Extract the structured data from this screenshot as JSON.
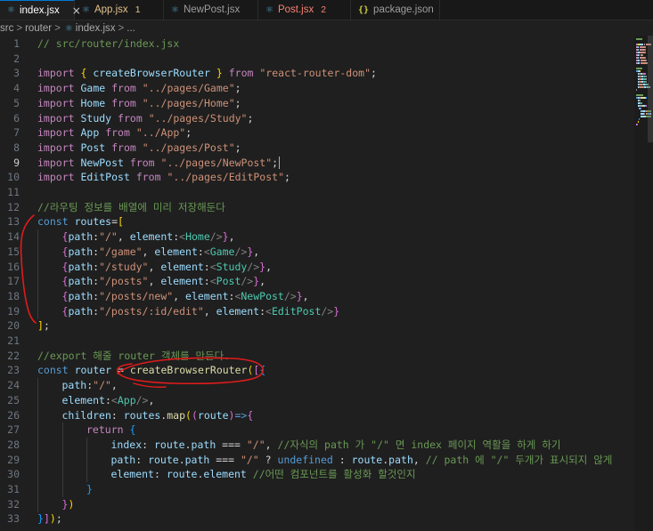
{
  "tabs": [
    {
      "label": "index.jsx",
      "icon": "react-icon",
      "active": true,
      "close": "×"
    },
    {
      "label": "App.jsx",
      "icon": "react-icon",
      "count": "1",
      "state": "modified"
    },
    {
      "label": "NewPost.jsx",
      "icon": "react-icon"
    },
    {
      "label": "Post.jsx",
      "icon": "react-icon",
      "count": "2",
      "state": "error"
    },
    {
      "label": "package.json",
      "icon": "json-icon",
      "icon_glyph": "{}"
    }
  ],
  "breadcrumb": [
    "src",
    "router",
    "index.jsx",
    "..."
  ],
  "breadcrumb_sep": ">",
  "current_line": 9,
  "lines": [
    {
      "n": "1",
      "indent": 0,
      "tokens": [
        {
          "c": "c",
          "t": "// src/router/index.jsx"
        }
      ]
    },
    {
      "n": "2",
      "indent": 0,
      "tokens": []
    },
    {
      "n": "3",
      "indent": 0,
      "tokens": [
        {
          "c": "kc",
          "t": "import"
        },
        {
          "c": "p",
          "t": " "
        },
        {
          "c": "b1",
          "t": "{"
        },
        {
          "c": "p",
          "t": " "
        },
        {
          "c": "v",
          "t": "createBrowserRouter"
        },
        {
          "c": "p",
          "t": " "
        },
        {
          "c": "b1",
          "t": "}"
        },
        {
          "c": "p",
          "t": " "
        },
        {
          "c": "kc",
          "t": "from"
        },
        {
          "c": "p",
          "t": " "
        },
        {
          "c": "s",
          "t": "\"react-router-dom\""
        },
        {
          "c": "p",
          "t": ";"
        }
      ]
    },
    {
      "n": "4",
      "indent": 0,
      "tokens": [
        {
          "c": "kc",
          "t": "import"
        },
        {
          "c": "p",
          "t": " "
        },
        {
          "c": "v",
          "t": "Game"
        },
        {
          "c": "p",
          "t": " "
        },
        {
          "c": "kc",
          "t": "from"
        },
        {
          "c": "p",
          "t": " "
        },
        {
          "c": "s",
          "t": "\"../pages/Game\""
        },
        {
          "c": "p",
          "t": ";"
        }
      ]
    },
    {
      "n": "5",
      "indent": 0,
      "tokens": [
        {
          "c": "kc",
          "t": "import"
        },
        {
          "c": "p",
          "t": " "
        },
        {
          "c": "v",
          "t": "Home"
        },
        {
          "c": "p",
          "t": " "
        },
        {
          "c": "kc",
          "t": "from"
        },
        {
          "c": "p",
          "t": " "
        },
        {
          "c": "s",
          "t": "\"../pages/Home\""
        },
        {
          "c": "p",
          "t": ";"
        }
      ]
    },
    {
      "n": "6",
      "indent": 0,
      "tokens": [
        {
          "c": "kc",
          "t": "import"
        },
        {
          "c": "p",
          "t": " "
        },
        {
          "c": "v",
          "t": "Study"
        },
        {
          "c": "p",
          "t": " "
        },
        {
          "c": "kc",
          "t": "from"
        },
        {
          "c": "p",
          "t": " "
        },
        {
          "c": "s",
          "t": "\"../pages/Study\""
        },
        {
          "c": "p",
          "t": ";"
        }
      ]
    },
    {
      "n": "7",
      "indent": 0,
      "tokens": [
        {
          "c": "kc",
          "t": "import"
        },
        {
          "c": "p",
          "t": " "
        },
        {
          "c": "v",
          "t": "App"
        },
        {
          "c": "p",
          "t": " "
        },
        {
          "c": "kc",
          "t": "from"
        },
        {
          "c": "p",
          "t": " "
        },
        {
          "c": "s",
          "t": "\"../App\""
        },
        {
          "c": "p",
          "t": ";"
        }
      ]
    },
    {
      "n": "8",
      "indent": 0,
      "tokens": [
        {
          "c": "kc",
          "t": "import"
        },
        {
          "c": "p",
          "t": " "
        },
        {
          "c": "v",
          "t": "Post"
        },
        {
          "c": "p",
          "t": " "
        },
        {
          "c": "kc",
          "t": "from"
        },
        {
          "c": "p",
          "t": " "
        },
        {
          "c": "s",
          "t": "\"../pages/Post\""
        },
        {
          "c": "p",
          "t": ";"
        }
      ]
    },
    {
      "n": "9",
      "indent": 0,
      "tokens": [
        {
          "c": "kc",
          "t": "import"
        },
        {
          "c": "p",
          "t": " "
        },
        {
          "c": "v",
          "t": "NewPost"
        },
        {
          "c": "p",
          "t": " "
        },
        {
          "c": "kc",
          "t": "from"
        },
        {
          "c": "p",
          "t": " "
        },
        {
          "c": "s",
          "t": "\"../pages/NewPost\""
        },
        {
          "c": "p",
          "t": ";"
        }
      ]
    },
    {
      "n": "10",
      "indent": 0,
      "tokens": [
        {
          "c": "kc",
          "t": "import"
        },
        {
          "c": "p",
          "t": " "
        },
        {
          "c": "v",
          "t": "EditPost"
        },
        {
          "c": "p",
          "t": " "
        },
        {
          "c": "kc",
          "t": "from"
        },
        {
          "c": "p",
          "t": " "
        },
        {
          "c": "s",
          "t": "\"../pages/EditPost\""
        },
        {
          "c": "p",
          "t": ";"
        }
      ]
    },
    {
      "n": "11",
      "indent": 0,
      "tokens": []
    },
    {
      "n": "12",
      "indent": 0,
      "tokens": [
        {
          "c": "c",
          "t": "//라우팅 정보를 배열에 미리 저장해둔다"
        }
      ]
    },
    {
      "n": "13",
      "indent": 0,
      "tokens": [
        {
          "c": "k",
          "t": "const"
        },
        {
          "c": "p",
          "t": " "
        },
        {
          "c": "v",
          "t": "routes"
        },
        {
          "c": "p",
          "t": "="
        },
        {
          "c": "b1",
          "t": "["
        }
      ]
    },
    {
      "n": "14",
      "indent": 1,
      "tokens": [
        {
          "c": "b2",
          "t": "{"
        },
        {
          "c": "v",
          "t": "path"
        },
        {
          "c": "p",
          "t": ":"
        },
        {
          "c": "s",
          "t": "\"/\""
        },
        {
          "c": "p",
          "t": ", "
        },
        {
          "c": "v",
          "t": "element"
        },
        {
          "c": "p",
          "t": ":"
        },
        {
          "c": "g",
          "t": "<"
        },
        {
          "c": "t",
          "t": "Home"
        },
        {
          "c": "g",
          "t": "/>"
        },
        {
          "c": "b2",
          "t": "}"
        },
        {
          "c": "p",
          "t": ","
        }
      ]
    },
    {
      "n": "15",
      "indent": 1,
      "tokens": [
        {
          "c": "b2",
          "t": "{"
        },
        {
          "c": "v",
          "t": "path"
        },
        {
          "c": "p",
          "t": ":"
        },
        {
          "c": "s",
          "t": "\"/game\""
        },
        {
          "c": "p",
          "t": ", "
        },
        {
          "c": "v",
          "t": "element"
        },
        {
          "c": "p",
          "t": ":"
        },
        {
          "c": "g",
          "t": "<"
        },
        {
          "c": "t",
          "t": "Game"
        },
        {
          "c": "g",
          "t": "/>"
        },
        {
          "c": "b2",
          "t": "}"
        },
        {
          "c": "p",
          "t": ","
        }
      ]
    },
    {
      "n": "16",
      "indent": 1,
      "tokens": [
        {
          "c": "b2",
          "t": "{"
        },
        {
          "c": "v",
          "t": "path"
        },
        {
          "c": "p",
          "t": ":"
        },
        {
          "c": "s",
          "t": "\"/study\""
        },
        {
          "c": "p",
          "t": ", "
        },
        {
          "c": "v",
          "t": "element"
        },
        {
          "c": "p",
          "t": ":"
        },
        {
          "c": "g",
          "t": "<"
        },
        {
          "c": "t",
          "t": "Study"
        },
        {
          "c": "g",
          "t": "/>"
        },
        {
          "c": "b2",
          "t": "}"
        },
        {
          "c": "p",
          "t": ","
        }
      ]
    },
    {
      "n": "17",
      "indent": 1,
      "tokens": [
        {
          "c": "b2",
          "t": "{"
        },
        {
          "c": "v",
          "t": "path"
        },
        {
          "c": "p",
          "t": ":"
        },
        {
          "c": "s",
          "t": "\"/posts\""
        },
        {
          "c": "p",
          "t": ", "
        },
        {
          "c": "v",
          "t": "element"
        },
        {
          "c": "p",
          "t": ":"
        },
        {
          "c": "g",
          "t": "<"
        },
        {
          "c": "t",
          "t": "Post"
        },
        {
          "c": "g",
          "t": "/>"
        },
        {
          "c": "b2",
          "t": "}"
        },
        {
          "c": "p",
          "t": ","
        }
      ]
    },
    {
      "n": "18",
      "indent": 1,
      "tokens": [
        {
          "c": "b2",
          "t": "{"
        },
        {
          "c": "v",
          "t": "path"
        },
        {
          "c": "p",
          "t": ":"
        },
        {
          "c": "s",
          "t": "\"/posts/new\""
        },
        {
          "c": "p",
          "t": ", "
        },
        {
          "c": "v",
          "t": "element"
        },
        {
          "c": "p",
          "t": ":"
        },
        {
          "c": "g",
          "t": "<"
        },
        {
          "c": "t",
          "t": "NewPost"
        },
        {
          "c": "g",
          "t": "/>"
        },
        {
          "c": "b2",
          "t": "}"
        },
        {
          "c": "p",
          "t": ","
        }
      ]
    },
    {
      "n": "19",
      "indent": 1,
      "tokens": [
        {
          "c": "b2",
          "t": "{"
        },
        {
          "c": "v",
          "t": "path"
        },
        {
          "c": "p",
          "t": ":"
        },
        {
          "c": "s",
          "t": "\"/posts/:id/edit\""
        },
        {
          "c": "p",
          "t": ", "
        },
        {
          "c": "v",
          "t": "element"
        },
        {
          "c": "p",
          "t": ":"
        },
        {
          "c": "g",
          "t": "<"
        },
        {
          "c": "t",
          "t": "EditPost"
        },
        {
          "c": "g",
          "t": "/>"
        },
        {
          "c": "b2",
          "t": "}"
        }
      ]
    },
    {
      "n": "20",
      "indent": 0,
      "tokens": [
        {
          "c": "b1",
          "t": "]"
        },
        {
          "c": "p",
          "t": ";"
        }
      ]
    },
    {
      "n": "21",
      "indent": 0,
      "tokens": []
    },
    {
      "n": "22",
      "indent": 0,
      "tokens": [
        {
          "c": "c",
          "t": "//export 해줄 router 객체를 만든다."
        }
      ]
    },
    {
      "n": "23",
      "indent": 0,
      "tokens": [
        {
          "c": "k",
          "t": "const"
        },
        {
          "c": "p",
          "t": " "
        },
        {
          "c": "v",
          "t": "router"
        },
        {
          "c": "p",
          "t": " = "
        },
        {
          "c": "f",
          "t": "createBrowserRouter"
        },
        {
          "c": "b1",
          "t": "("
        },
        {
          "c": "b2",
          "t": "["
        },
        {
          "c": "b3",
          "t": "{"
        }
      ]
    },
    {
      "n": "24",
      "indent": 1,
      "tokens": [
        {
          "c": "v",
          "t": "path"
        },
        {
          "c": "p",
          "t": ":"
        },
        {
          "c": "s",
          "t": "\"/\""
        },
        {
          "c": "p",
          "t": ","
        }
      ]
    },
    {
      "n": "25",
      "indent": 1,
      "tokens": [
        {
          "c": "v",
          "t": "element"
        },
        {
          "c": "p",
          "t": ":"
        },
        {
          "c": "g",
          "t": "<"
        },
        {
          "c": "t",
          "t": "App"
        },
        {
          "c": "g",
          "t": "/>"
        },
        {
          "c": "p",
          "t": ","
        }
      ]
    },
    {
      "n": "26",
      "indent": 1,
      "tokens": [
        {
          "c": "v",
          "t": "children"
        },
        {
          "c": "p",
          "t": ": "
        },
        {
          "c": "v",
          "t": "routes"
        },
        {
          "c": "p",
          "t": "."
        },
        {
          "c": "f",
          "t": "map"
        },
        {
          "c": "b1",
          "t": "("
        },
        {
          "c": "b2",
          "t": "("
        },
        {
          "c": "v",
          "t": "route"
        },
        {
          "c": "b2",
          "t": ")"
        },
        {
          "c": "k",
          "t": "=>"
        },
        {
          "c": "b2",
          "t": "{"
        }
      ]
    },
    {
      "n": "27",
      "indent": 2,
      "tokens": [
        {
          "c": "kc",
          "t": "return"
        },
        {
          "c": "p",
          "t": " "
        },
        {
          "c": "b3",
          "t": "{"
        }
      ]
    },
    {
      "n": "28",
      "indent": 3,
      "tokens": [
        {
          "c": "v",
          "t": "index"
        },
        {
          "c": "p",
          "t": ": "
        },
        {
          "c": "v",
          "t": "route"
        },
        {
          "c": "p",
          "t": "."
        },
        {
          "c": "v",
          "t": "path"
        },
        {
          "c": "p",
          "t": " === "
        },
        {
          "c": "s",
          "t": "\"/\""
        },
        {
          "c": "p",
          "t": ", "
        },
        {
          "c": "c",
          "t": "//자식의 path 가 \"/\" 면 index 페이지 역활을 하게 하기"
        }
      ]
    },
    {
      "n": "29",
      "indent": 3,
      "tokens": [
        {
          "c": "v",
          "t": "path"
        },
        {
          "c": "p",
          "t": ": "
        },
        {
          "c": "v",
          "t": "route"
        },
        {
          "c": "p",
          "t": "."
        },
        {
          "c": "v",
          "t": "path"
        },
        {
          "c": "p",
          "t": " === "
        },
        {
          "c": "s",
          "t": "\"/\""
        },
        {
          "c": "p",
          "t": " ? "
        },
        {
          "c": "k",
          "t": "undefined"
        },
        {
          "c": "p",
          "t": " : "
        },
        {
          "c": "v",
          "t": "route"
        },
        {
          "c": "p",
          "t": "."
        },
        {
          "c": "v",
          "t": "path"
        },
        {
          "c": "p",
          "t": ", "
        },
        {
          "c": "c",
          "t": "// path 에 \"/\" 두개가 표시되지 않게"
        }
      ]
    },
    {
      "n": "30",
      "indent": 3,
      "tokens": [
        {
          "c": "v",
          "t": "element"
        },
        {
          "c": "p",
          "t": ": "
        },
        {
          "c": "v",
          "t": "route"
        },
        {
          "c": "p",
          "t": "."
        },
        {
          "c": "v",
          "t": "element"
        },
        {
          "c": "p",
          "t": " "
        },
        {
          "c": "c",
          "t": "//어떤 컴포넌트를 활성화 할것인지"
        }
      ]
    },
    {
      "n": "31",
      "indent": 2,
      "tokens": [
        {
          "c": "b3",
          "t": "}"
        }
      ]
    },
    {
      "n": "32",
      "indent": 1,
      "tokens": [
        {
          "c": "b2",
          "t": "}"
        },
        {
          "c": "b1",
          "t": ")"
        }
      ]
    },
    {
      "n": "33",
      "indent": 0,
      "tokens": [
        {
          "c": "b3",
          "t": "}"
        },
        {
          "c": "b2",
          "t": "]"
        },
        {
          "c": "b1",
          "t": ")"
        },
        {
          "c": "p",
          "t": ";"
        }
      ]
    }
  ],
  "colors": {
    "background": "#1f1f1f",
    "tab_active_border": "#0078d4",
    "keyword": "#569cd6",
    "import_keyword": "#c586c0",
    "string": "#ce9178",
    "variable": "#9cdcfe",
    "function": "#dcdcaa",
    "comment": "#6a9955",
    "component": "#4ec9b0",
    "annotation": "#e01b1b"
  }
}
